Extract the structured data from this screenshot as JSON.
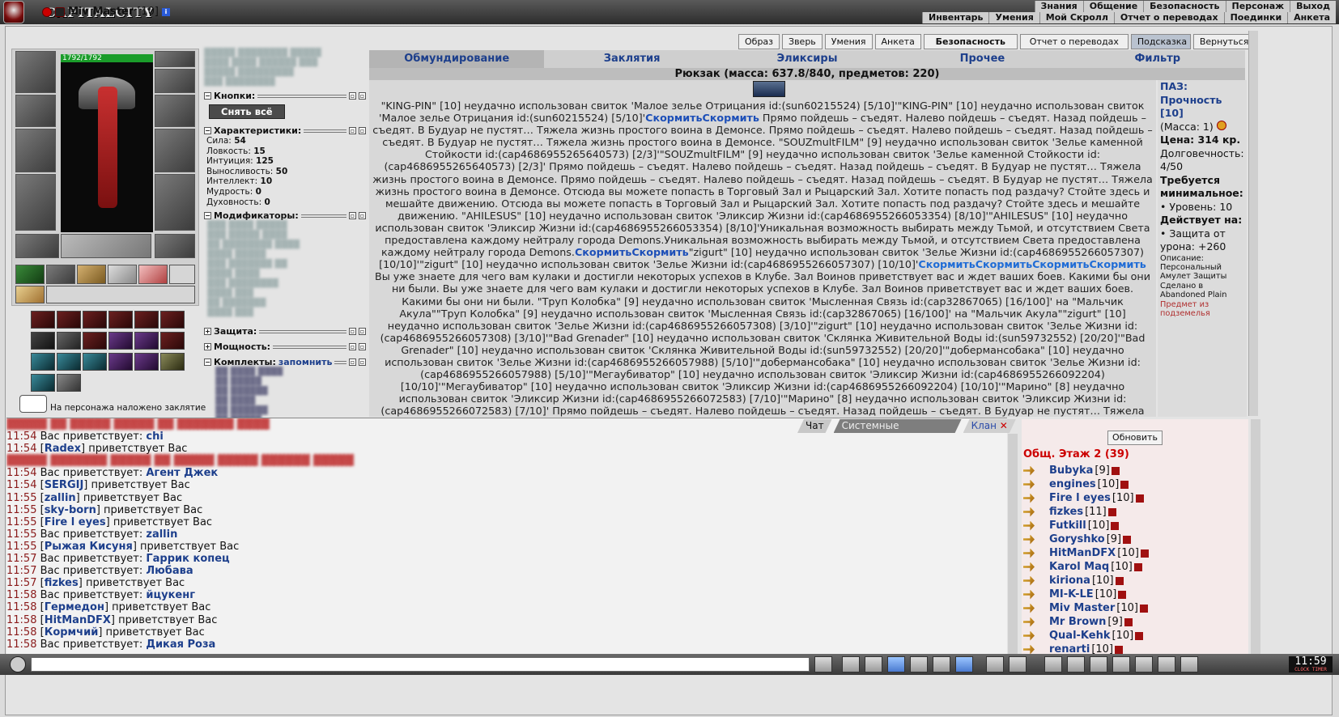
{
  "app": {
    "brand": "CAPITALCITY"
  },
  "nav": {
    "row1": [
      "Знания",
      "Общение",
      "Безопасность",
      "Персонаж",
      "Выход"
    ],
    "row2": [
      "Инвентарь",
      "Умения",
      "Мой Скролл",
      "Отчет о переводах",
      "Поединки",
      "Анкета"
    ]
  },
  "character": {
    "name": "Miv Master",
    "level": "[10]",
    "hp": "1792/1792"
  },
  "actions": [
    "Образ",
    "Зверь",
    "Умения",
    "Анкета",
    "Безопасность",
    "Отчет о переводах",
    "Подсказка",
    "Вернуться"
  ],
  "panels": {
    "buttons_title": "Кнопки:",
    "undress": "Снять всё",
    "stats_title": "Характеристики:",
    "stats": [
      {
        "label": "Сила:",
        "value": "54"
      },
      {
        "label": "Ловкость:",
        "value": "15"
      },
      {
        "label": "Интуиция:",
        "value": "125"
      },
      {
        "label": "Выносливость:",
        "value": "50"
      },
      {
        "label": "Интеллект:",
        "value": "10"
      },
      {
        "label": "Мудрость:",
        "value": "0"
      },
      {
        "label": "Духовность:",
        "value": "0"
      }
    ],
    "mods_title": "Модификаторы:",
    "protection_title": "Защита:",
    "power_title": "Мощность:",
    "sets_title": "Комплекты:",
    "sets_link": "запомнить",
    "spell_note": "На персонажа наложено заклятие"
  },
  "inventory": {
    "tabs": [
      "Обмундирование",
      "Заклятия",
      "Эликсиры",
      "Прочее",
      "Фильтр"
    ],
    "backpack": "Рюкзак (масса: 637.8/840, предметов: 220)",
    "log_parts": [
      {
        "t": "\"KING-PIN\" [10] неудачно использован свиток 'Малое зелье Отрицания id:(sun60215524) [5/10]'\"KING-PIN\" [10] неудачно использован свиток 'Малое зелье Отрицания id:(sun60215524) [5/10]'",
        "c": ""
      },
      {
        "t": "СкормитьСкормить",
        "c": "feed"
      },
      {
        "t": " Прямо пойдешь – съедят. Налево пойдешь – съедят. Назад пойдешь – съедят. В Будуар не пустят… Тяжела жизнь простого воина в Демонсе. Прямо пойдешь – съедят. Налево пойдешь – съедят. Назад пойдешь – съедят. В Будуар не пустят… Тяжела жизнь простого воина в Демонсе. \"SOUZmultFILM\" [9] неудачно использован свиток 'Зелье каменной Стойкости id:(cap4686955265640573) [2/3]'\"SOUZmultFILM\" [9] неудачно использован свиток 'Зелье каменной Стойкости id:(cap4686955265640573) [2/3]' Прямо пойдешь – съедят. Налево пойдешь – съедят. Назад пойдешь – съедят. В Будуар не пустят… Тяжела жизнь простого воина в Демонсе. Прямо пойдешь – съедят. Налево пойдешь – съедят. Назад пойдешь – съедят. В Будуар не пустят… Тяжела жизнь простого воина в Демонсе. Отсюда вы можете попасть в Торговый Зал и Рыцарский Зал. Хотите попасть под раздачу? Стойте здесь и мешайте движению. Отсюда вы можете попасть в Торговый Зал и Рыцарский Зал. Хотите попасть под раздачу? Стойте здесь и мешайте движению. \"AHILESUS\" [10] неудачно использован свиток 'Эликсир Жизни id:(cap4686955266053354) [8/10]'\"AHILESUS\" [10] неудачно использован свиток 'Эликсир Жизни id:(cap4686955266053354) [8/10]'Уникальная возможность выбирать между Тьмой, и отсутствием Света предоставлена каждому нейтралу города Demons.Уникальная возможность выбирать между Тьмой, и отсутствием Света предоставлена каждому нейтралу города Demons.",
        "c": ""
      },
      {
        "t": "СкормитьСкормить",
        "c": "feed"
      },
      {
        "t": "\"zigurt\" [10] неудачно использован свиток 'Зелье Жизни id:(cap4686955266057307) [10/10]'\"zigurt\" [10] неудачно использован свиток 'Зелье Жизни id:(cap4686955266057307) [10/10]'",
        "c": ""
      },
      {
        "t": "СкормитьСкормитьСкормитьСкормить",
        "c": "feed2"
      },
      {
        "t": " Вы уже знаете для чего вам кулаки и достигли некоторых успехов в Клубе. Зал Воинов приветствует вас и ждет ваших боев. Какими бы они ни были. Вы уже знаете для чего вам кулаки и достигли некоторых успехов в Клубе. Зал Воинов приветствует вас и ждет ваших боев. Какими бы они ни были. \"Труп Колобка\" [9] неудачно использован свиток 'Мысленная Связь id:(cap32867065) [16/100]' на \"Мальчик Акула\"\"Труп Колобка\" [9] неудачно использован свиток 'Мысленная Связь id:(cap32867065) [16/100]' на \"Мальчик Акула\"\"zigurt\" [10] неудачно использован свиток 'Зелье Жизни id:(cap4686955266057308) [3/10]'\"zigurt\" [10] неудачно использован свиток 'Зелье Жизни id:(cap4686955266057308) [3/10]'\"Bad Grenader\" [10] неудачно использован свиток 'Склянка Живительной Воды id:(sun59732552) [20/20]'\"Bad Grenader\" [10] неудачно использован свиток 'Склянка Живительной Воды id:(sun59732552) [20/20]'\"добермансобака\" [10] неудачно использован свиток 'Зелье Жизни id:(cap4686955266057988) [5/10]'\"добермансобака\" [10] неудачно использован свиток 'Зелье Жизни id:(cap4686955266057988) [5/10]'\"Мегаубиватор\" [10] неудачно использован свиток 'Эликсир Жизни id:(cap4686955266092204) [10/10]'\"Мегаубиватор\" [10] неудачно использован свиток 'Эликсир Жизни id:(cap4686955266092204) [10/10]'\"Марино\" [8] неудачно использован свиток 'Эликсир Жизни id:(cap4686955266072583) [7/10]'\"Марино\" [8] неудачно использован свиток 'Эликсир Жизни id:(cap4686955266072583) [7/10]' Прямо пойдешь – съедят. Налево пойдешь – съедят. Назад пойдешь – съедят. В Будуар не пустят… Тяжела жизнь простого воина в Демонсе. Прямо пойдешь – съедят. Налево пойдешь – съедят. Назад пойдешь – съедят. В Будуар не пустят…",
        "c": ""
      }
    ],
    "item": {
      "name": "ПАЗ: Прочность [10]",
      "mass": "(Масса: 1)",
      "price": "Цена: 314 кр.",
      "durability": "Долговечность: 4/50",
      "req_title": "Требуется минимальное:",
      "req_level": "• Уровень: 10",
      "acts_title": "Действует на:",
      "acts_val": "• Защита от урона: +260",
      "desc": "Описание: Персональный Амулет Защиты Сделано в Abandoned Plain",
      "note": "Предмет из подземелья"
    }
  },
  "chat": {
    "tabs": [
      "Чат",
      "Системные сообщения",
      "Клан"
    ],
    "lines": [
      {
        "time": "11:54",
        "pre": "Вас приветствует: ",
        "name": "chi",
        "post": ""
      },
      {
        "time": "11:54",
        "pre": "[",
        "name": "Radex",
        "post": "] приветствует Вас"
      },
      {
        "time": "11:54",
        "pre": "Вас приветствует: ",
        "name": "Агент Джек",
        "post": ""
      },
      {
        "time": "11:54",
        "pre": "[",
        "name": "SERGIJ",
        "post": "] приветствует Вас"
      },
      {
        "time": "11:55",
        "pre": "[",
        "name": "zallin",
        "post": "] приветствует Вас"
      },
      {
        "time": "11:55",
        "pre": "[",
        "name": "sky-born",
        "post": "] приветствует Вас"
      },
      {
        "time": "11:55",
        "pre": "[",
        "name": "Fire l eyes",
        "post": "] приветствует Вас"
      },
      {
        "time": "11:55",
        "pre": "Вас приветствует: ",
        "name": "zallin",
        "post": ""
      },
      {
        "time": "11:55",
        "pre": "[",
        "name": "Рыжая Кисуня",
        "post": "] приветствует Вас"
      },
      {
        "time": "11:57",
        "pre": "Вас приветствует: ",
        "name": "Гаррик копец",
        "post": ""
      },
      {
        "time": "11:57",
        "pre": "Вас приветствует: ",
        "name": "Любава",
        "post": ""
      },
      {
        "time": "11:57",
        "pre": "[",
        "name": "fizkes",
        "post": "] приветствует Вас"
      },
      {
        "time": "11:58",
        "pre": "Вас приветствует: ",
        "name": "йцукенг",
        "post": ""
      },
      {
        "time": "11:58",
        "pre": "[",
        "name": "Гермедон",
        "post": "] приветствует Вас"
      },
      {
        "time": "11:58",
        "pre": "[",
        "name": "HitManDFX",
        "post": "] приветствует Вас"
      },
      {
        "time": "11:58",
        "pre": "[",
        "name": "Кормчий",
        "post": "] приветствует Вас"
      },
      {
        "time": "11:58",
        "pre": "Вас приветствует: ",
        "name": "Дикая Роза",
        "post": ""
      }
    ]
  },
  "online": {
    "refresh": "Обновить",
    "header": "Общ. Этаж 2 (39)",
    "users": [
      {
        "name": "Bubyka",
        "lv": "[9]"
      },
      {
        "name": "engines",
        "lv": "[10]"
      },
      {
        "name": "Fire l eyes",
        "lv": "[10]"
      },
      {
        "name": "fizkes",
        "lv": "[11]"
      },
      {
        "name": "Futkill",
        "lv": "[10]"
      },
      {
        "name": "Goryshko",
        "lv": "[9]"
      },
      {
        "name": "HitManDFX",
        "lv": "[10]"
      },
      {
        "name": "Karol Maq",
        "lv": "[10]"
      },
      {
        "name": "kiriona",
        "lv": "[10]"
      },
      {
        "name": "MI-K-LE",
        "lv": "[10]"
      },
      {
        "name": "Miv Master",
        "lv": "[10]"
      },
      {
        "name": "Mr Brown",
        "lv": "[9]"
      },
      {
        "name": "Qual-Kehk",
        "lv": "[10]"
      },
      {
        "name": "renarti",
        "lv": "[10]"
      }
    ]
  },
  "clock": {
    "time": "11:59",
    "label": "CLOCK TIMER"
  }
}
